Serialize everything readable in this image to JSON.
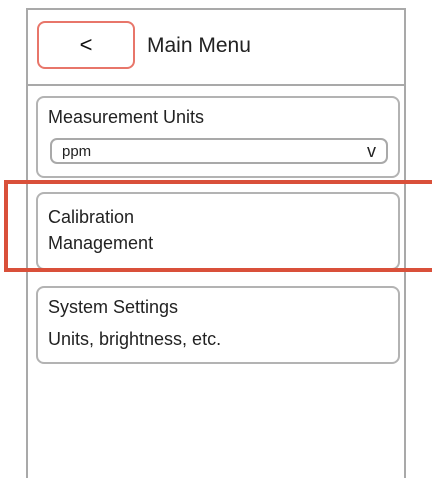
{
  "header": {
    "back_label": "<",
    "title": "Main Menu"
  },
  "menu": {
    "measurement_units": {
      "label": "Measurement Units",
      "selected": "ppm",
      "dropdown_glyph": "v"
    },
    "calibration": {
      "line1": "Calibration",
      "line2": "Management"
    },
    "system_settings": {
      "title": "System Settings",
      "subtitle": "Units, brightness, etc."
    }
  },
  "colors": {
    "back_button_border": "#e8766a",
    "highlight": "#d9503a",
    "frame": "#a9a9a9"
  }
}
